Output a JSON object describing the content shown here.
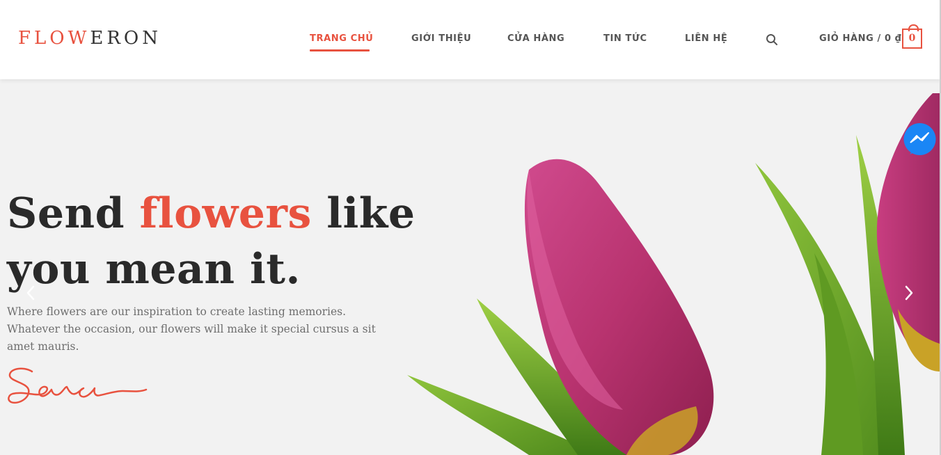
{
  "brand": {
    "logo_part1": "FLOW",
    "logo_part2": "ERON"
  },
  "nav": {
    "items": [
      {
        "label": "TRANG CHỦ",
        "active": true
      },
      {
        "label": "GIỚI THIỆU",
        "active": false
      },
      {
        "label": "CỬA HÀNG",
        "active": false
      },
      {
        "label": "TIN TỨC",
        "active": false
      },
      {
        "label": "LIÊN HỆ",
        "active": false
      }
    ],
    "search_icon": "search-icon"
  },
  "cart": {
    "label": "GIỎ HÀNG / 0 ₫",
    "count": "0",
    "icon": "shopping-bag-icon"
  },
  "hero": {
    "headline_part1": "Send ",
    "headline_accent": "flowers",
    "headline_part2": " like you mean it.",
    "description": "Where flowers are our inspiration to create lasting memories. Whatever the occasion, our flowers will make it special cursus a sit amet mauris.",
    "signature": "Sara",
    "prev_icon": "chevron-left-icon",
    "next_icon": "chevron-right-icon"
  },
  "chat": {
    "icon": "messenger-icon"
  },
  "colors": {
    "accent": "#e8523f",
    "nav_text": "#555555",
    "headline": "#2a2a2a",
    "hero_bg": "#f2f2f2",
    "messenger": "#0a7cff"
  }
}
